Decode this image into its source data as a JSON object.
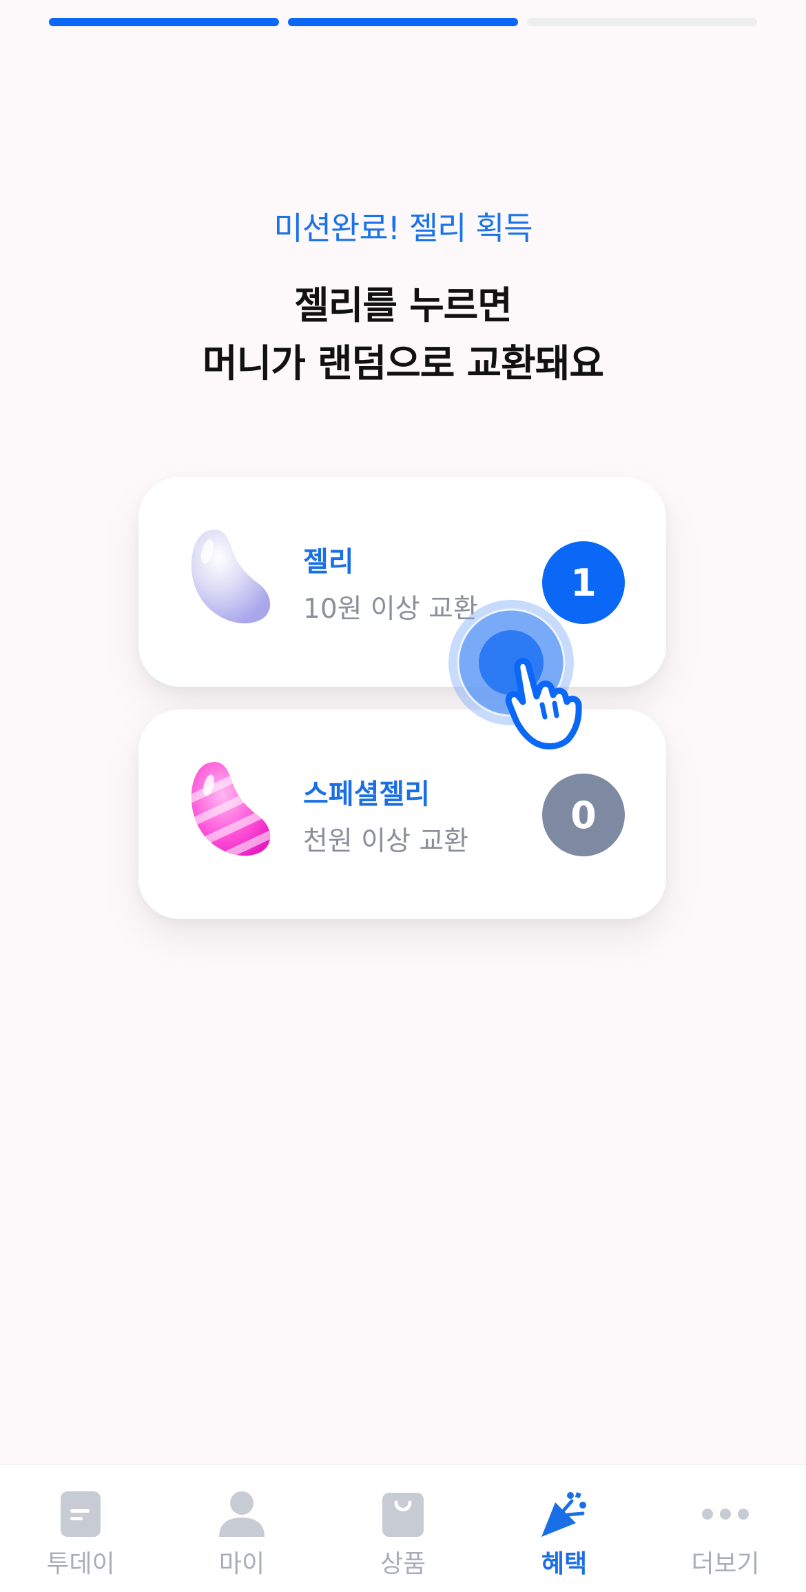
{
  "progress": {
    "total_steps": 3,
    "completed_steps": 2
  },
  "header": {
    "mission_text": "미션완료! 젤리 획득",
    "title_line1": "젤리를 누르면",
    "title_line2": "머니가 랜덤으로 교환돼요"
  },
  "cards": [
    {
      "name": "젤리",
      "desc": "10원 이상 교환",
      "count": "1",
      "jelly_color": "#cfd2f5"
    },
    {
      "name": "스페셜젤리",
      "desc": "천원 이상 교환",
      "count": "0",
      "jelly_color": "#ff5ad8"
    }
  ],
  "tabs": [
    {
      "label": "투데이",
      "icon": "document-icon",
      "active": false
    },
    {
      "label": "마이",
      "icon": "person-icon",
      "active": false
    },
    {
      "label": "상품",
      "icon": "shopping-bag-icon",
      "active": false
    },
    {
      "label": "혜택",
      "icon": "party-popper-icon",
      "active": true
    },
    {
      "label": "더보기",
      "icon": "more-dots-icon",
      "active": false
    }
  ],
  "colors": {
    "accent": "#0b67f5",
    "inactive_badge": "#7e8aa2",
    "tab_inactive": "#a8adb7"
  }
}
